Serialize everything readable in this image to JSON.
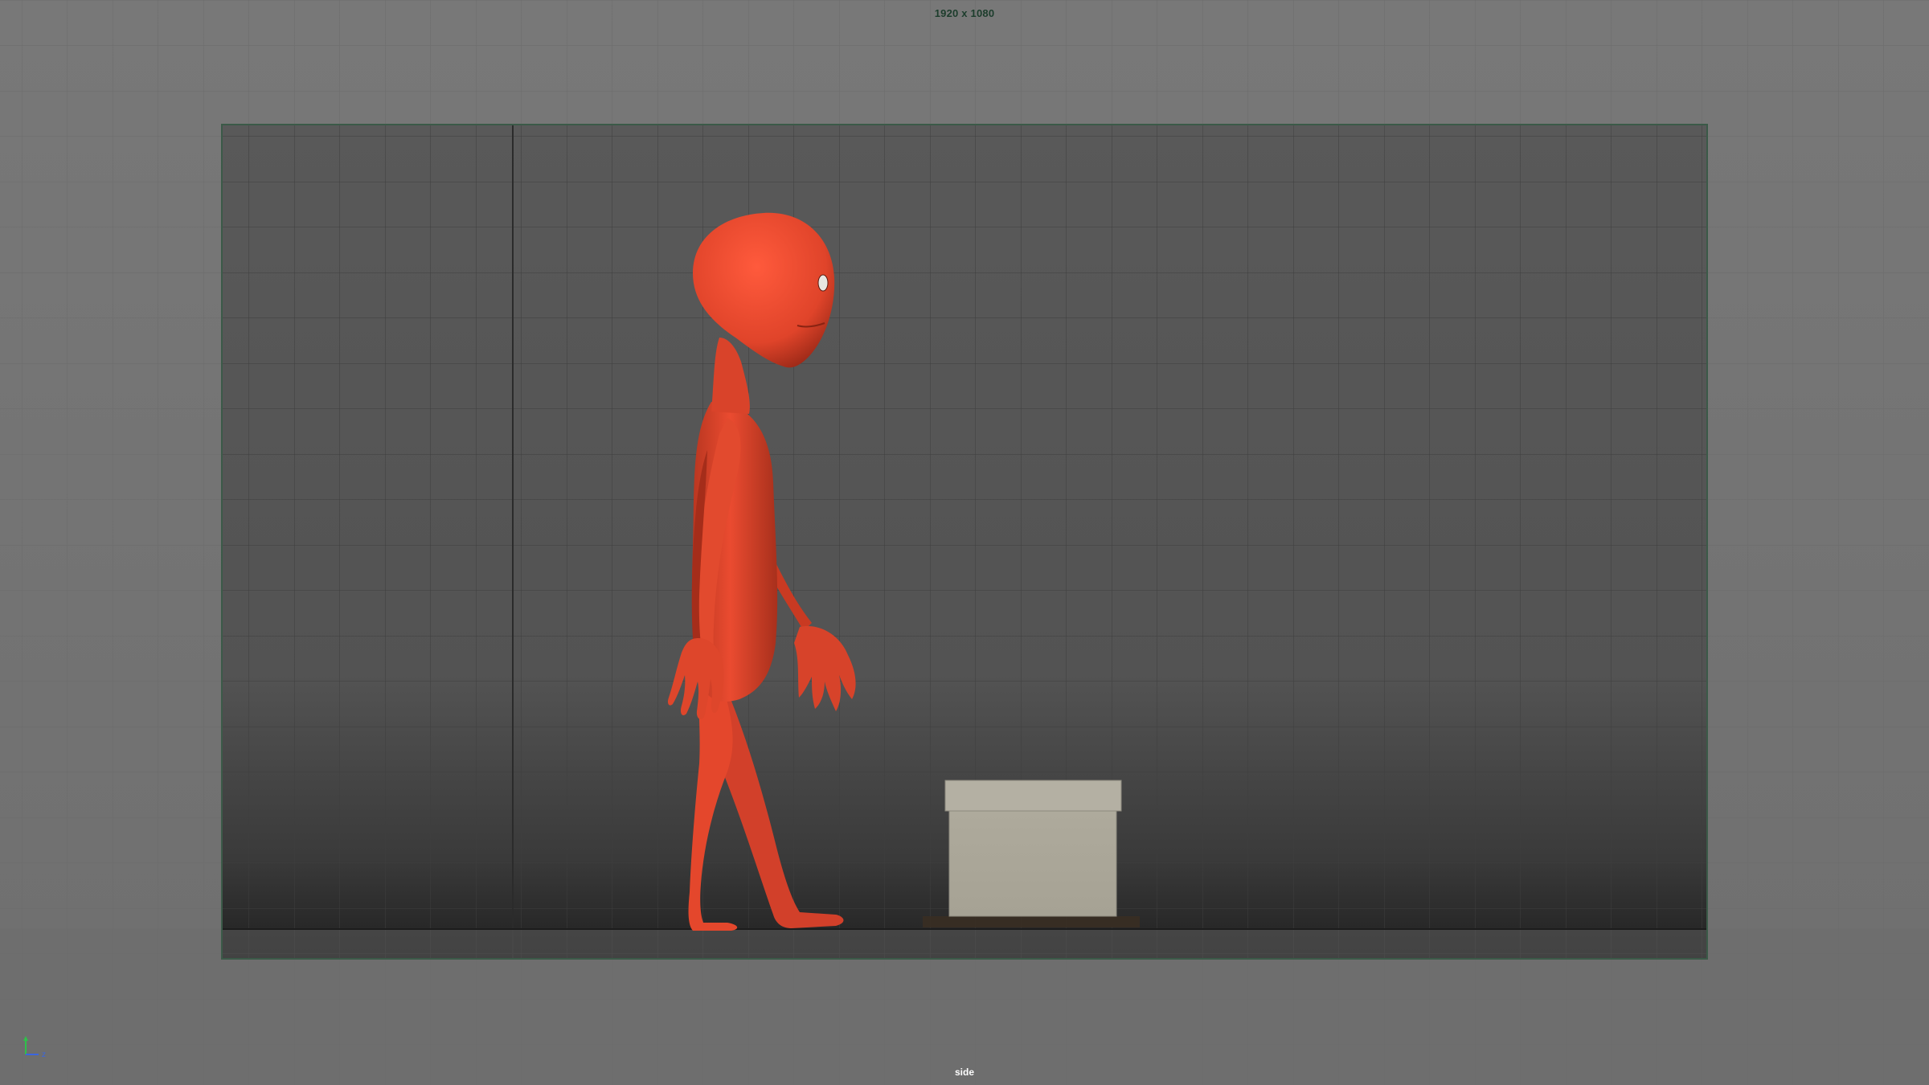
{
  "viewport": {
    "resolution_label": "1920 x 1080",
    "camera_label": "side",
    "view": "side-orthographic",
    "display": "shaded",
    "grid": true
  },
  "axis_gizmo": {
    "icon": "axis-gizmo-icon",
    "axes": [
      {
        "name": "y",
        "label": "",
        "color": "#2fc14a"
      },
      {
        "name": "z",
        "label": "z",
        "color": "#3a66e0"
      }
    ]
  },
  "scene": {
    "objects": [
      {
        "name": "character",
        "type": "biped-character",
        "color": "#e0442a"
      },
      {
        "name": "box",
        "type": "box-prop",
        "color": "#aeaa9c"
      }
    ]
  },
  "colors": {
    "background": "#767676",
    "resolution_gate": "#3b5a48",
    "grid_lines": "#2f2f2f",
    "character": "#e0442a",
    "box": "#aeaa9c"
  }
}
